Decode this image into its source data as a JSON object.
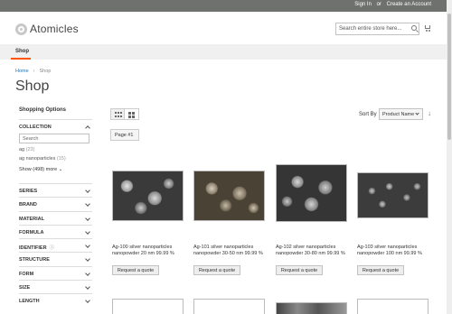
{
  "topbar": {
    "sign_in": "Sign In",
    "or": "or",
    "create_account": "Create an Account"
  },
  "header": {
    "logo": "Atomicles",
    "search_placeholder": "Search entire store here..."
  },
  "nav": {
    "shop": "Shop"
  },
  "breadcrumb": {
    "home": "Home",
    "current": "Shop"
  },
  "page_title": "Shop",
  "sidebar": {
    "title": "Shopping Options",
    "collection": {
      "title": "COLLECTION",
      "search_placeholder": "Search",
      "options": [
        {
          "label": "ag",
          "count": "(23)"
        },
        {
          "label": "ag nanoparticles",
          "count": "(15)"
        }
      ],
      "more": "Show (498) more"
    },
    "filters": [
      "SERIES",
      "BRAND",
      "MATERIAL",
      "FORMULA",
      "IDENTIFIER",
      "STRUCTURE",
      "FORM",
      "SIZE",
      "LENGTH"
    ]
  },
  "toolbar": {
    "sort_by": "Sort By",
    "sort_value": "Product Name",
    "page_label": "Page #1",
    "sort_dir_icon": "↓"
  },
  "products": [
    {
      "name": "Ag-100 silver nanoparticles nanopowder 20 nm 99.99 %",
      "button": "Request a quote"
    },
    {
      "name": "Ag-101 silver nanoparticles nanopowder 30-50 nm 99.99 %",
      "button": "Request a quote"
    },
    {
      "name": "Ag-102 silver nanoparticles nanopowder 30-80 nm 99.99 %",
      "button": "Request a quote"
    },
    {
      "name": "Ag-103 silver nanoparticles nanopowder 100 nm 99.99 %",
      "button": "Request a quote"
    }
  ],
  "colors": {
    "topbar": "#6e716e",
    "accent": "#ff5501",
    "link": "#1979c3"
  },
  "icons": [
    "search-icon",
    "cart-icon",
    "chevron-down-icon",
    "chevron-up-icon",
    "grid-view-icon",
    "list-view-icon",
    "info-icon",
    "sort-direction-icon"
  ]
}
